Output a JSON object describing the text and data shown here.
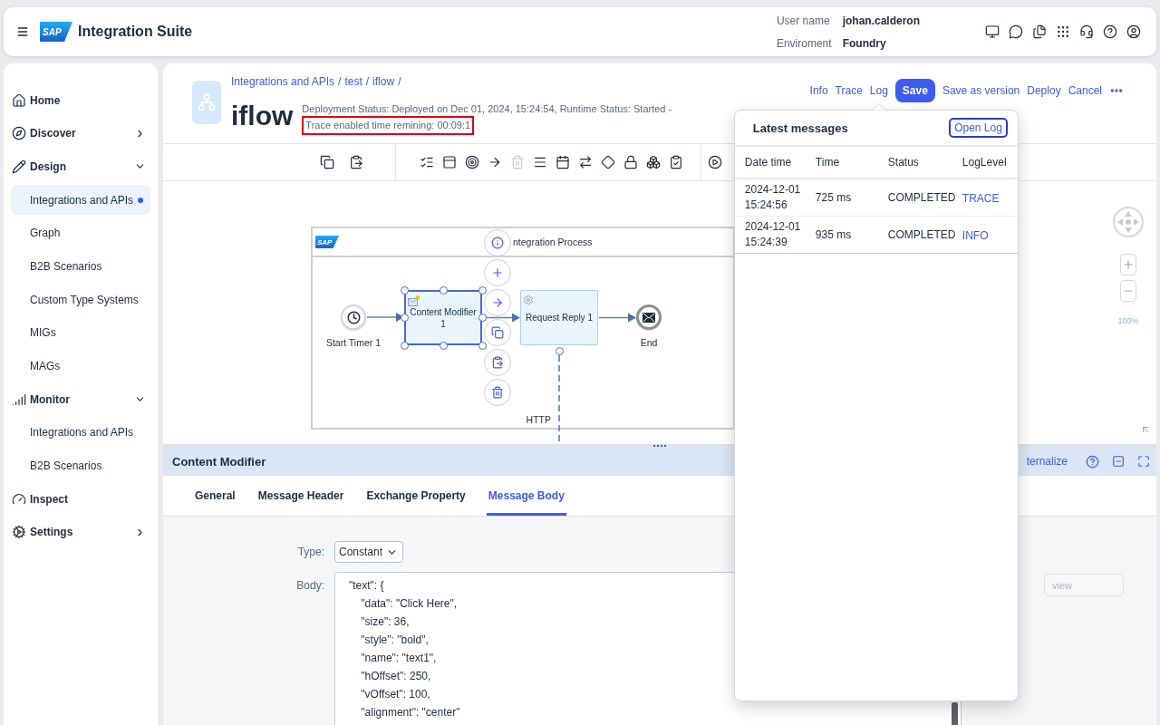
{
  "header": {
    "logo_text": "SAP",
    "product": "Integration Suite",
    "user_info": [
      {
        "label": "User name",
        "value": "johan.calderon"
      },
      {
        "label": "Enviroment",
        "value": "Foundry"
      }
    ]
  },
  "sidebar": {
    "items": [
      {
        "kind": "link",
        "label": "Home"
      },
      {
        "kind": "group",
        "label": "Discover",
        "expanded": false
      },
      {
        "kind": "group",
        "label": "Design",
        "expanded": true,
        "children": [
          {
            "label": "Integrations and APIs",
            "selected": true
          },
          {
            "label": "Graph",
            "selected": false
          },
          {
            "label": "B2B Scenarios",
            "selected": false
          },
          {
            "label": "Custom Type Systems",
            "selected": false
          },
          {
            "label": "MIGs",
            "selected": false
          },
          {
            "label": "MAGs",
            "selected": false
          }
        ]
      },
      {
        "kind": "group",
        "label": "Monitor",
        "expanded": true,
        "children": [
          {
            "label": "Integrations and APIs",
            "selected": false
          },
          {
            "label": "B2B Scenarios",
            "selected": false
          }
        ]
      },
      {
        "kind": "link",
        "label": "Inspect"
      },
      {
        "kind": "group",
        "label": "Settings",
        "expanded": false
      }
    ]
  },
  "artifact": {
    "breadcrumb": [
      {
        "label": "Integrations and APIs",
        "separator": "/"
      },
      {
        "label": "test",
        "separator": "/"
      },
      {
        "label": "iflow",
        "separator": "/"
      }
    ],
    "title": "iflow",
    "deployment_status": "Deployment Status: Deployed on Dec 01, 2024, 15:24:54, Runtime Status: Started -",
    "trace_status": {
      "text": "Trace enabled time remining: 00:09:1",
      "highlighted": true
    },
    "actions": [
      {
        "kind": "link",
        "label": "Info"
      },
      {
        "kind": "link",
        "label": "Trace"
      },
      {
        "kind": "popover_link",
        "label": "Log"
      },
      {
        "kind": "primary",
        "label": "Save"
      },
      {
        "kind": "link",
        "label": "Save as version"
      },
      {
        "kind": "link",
        "label": "Deploy"
      },
      {
        "kind": "link",
        "label": "Cancel"
      },
      {
        "kind": "overflow"
      }
    ]
  },
  "log_popup": {
    "open": true,
    "title": "Latest messages",
    "open_button": {
      "label": "Open Log",
      "focused": true
    },
    "columns": [
      "Date time",
      "Time",
      "Status",
      "LogLevel"
    ],
    "rows": [
      {
        "date_time": "2024-12-01 15:24:56",
        "time": "725 ms",
        "status": "COMPLETED",
        "log_level": "TRACE"
      },
      {
        "date_time": "2024-12-01 15:24:39",
        "time": "935 ms",
        "status": "COMPLETED",
        "log_level": "INFO"
      }
    ]
  },
  "toolbar": {
    "groups": [
      {
        "items": [
          {
            "disabled": false
          },
          {
            "disabled": false
          }
        ]
      },
      {
        "items": [
          {
            "disabled": false
          },
          {
            "disabled": false
          },
          {
            "disabled": false
          },
          {
            "disabled": false
          },
          {
            "disabled": true
          },
          {
            "disabled": false
          },
          {
            "disabled": false
          },
          {
            "disabled": false
          },
          {
            "disabled": false
          },
          {
            "disabled": false
          },
          {
            "disabled": false
          },
          {
            "disabled": false
          }
        ]
      },
      {
        "items": [
          {
            "disabled": false
          }
        ]
      }
    ]
  },
  "diagram": {
    "pool_logo_text": "SAP",
    "pool_title": "ntegration Process",
    "nodes": [
      {
        "kind": "start_timer",
        "label": "Start Timer 1",
        "selected": false
      },
      {
        "kind": "content_modifier",
        "label": "Content Modifier 1",
        "selected": true
      },
      {
        "kind": "request_reply",
        "label": "Request Reply 1",
        "selected": false
      },
      {
        "kind": "end",
        "label": "End",
        "selected": false
      }
    ],
    "connection_label": "HTTP",
    "zoom_label": "100%"
  },
  "properties": {
    "title": "Content Modifier",
    "header_link": "ternalize",
    "tabs": [
      {
        "label": "General",
        "selected": false
      },
      {
        "label": "Message Header",
        "selected": false
      },
      {
        "label": "Exchange Property",
        "selected": false
      },
      {
        "label": "Message Body",
        "selected": true
      }
    ],
    "type_label": "Type:",
    "type_value": "Constant",
    "body_label": "Body:",
    "body_value": "\"text\": {\n    \"data\": \"Click Here\",\n    \"size\": 36,\n    \"style\": \"bold\",\n    \"name\": \"text1\",\n    \"hOffset\": 250,\n    \"vOffset\": 100,\n    \"alignment\": \"center\"",
    "side_field_placeholder": "view"
  }
}
